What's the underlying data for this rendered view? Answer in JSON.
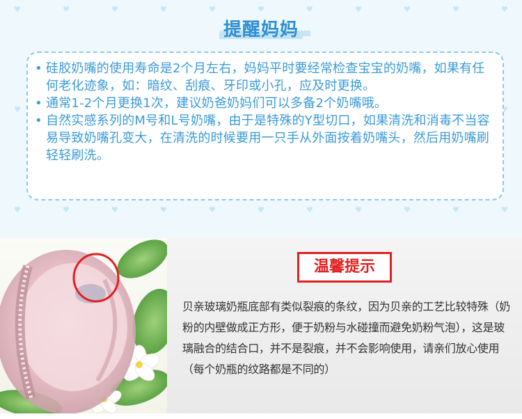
{
  "reminder": {
    "title": "提醒妈妈",
    "bullet_symbol": "•",
    "items": [
      {
        "text": "硅胶奶嘴的使用寿命是2个月左右，妈妈平时要经常检查宝宝的奶嘴，如果有任何老化迹象，如：暗纹、刮痕、牙印或小孔，应及时更换。"
      },
      {
        "text": "通常1-2个月更换1次，建议奶爸奶妈们可以多备2个奶嘴哦。"
      },
      {
        "text": "自然实感系列的M号和L号奶嘴，由于是特殊的Y型切口，如果清洗和消毒不当容易导致奶嘴孔变大，在清洗的时候要用一只手从外面按着奶嘴头，然后用奶嘴刷轻轻刷洗。"
      }
    ]
  },
  "tips": {
    "title": "温馨提示",
    "text": "贝亲玻璃奶瓶底部有类似裂痕的条纹，因为贝亲的工艺比较特殊（奶粉的内壁做成正方形，便于奶粉与水碰撞而避免奶粉气泡），这是玻璃融合的结合口，并不是裂痕，并不会影响使用，请亲们放心使用（每个奶瓶的纹路都是不同的）"
  },
  "photo": {
    "subject": "glass baby bottle base with highlighted seam",
    "highlight_color": "#e02020"
  },
  "colors": {
    "accent_blue": "#3b9ad8",
    "title_blue": "#2e8fd1",
    "dashed_border": "#8cc8ea",
    "tips_red": "#e02020"
  }
}
